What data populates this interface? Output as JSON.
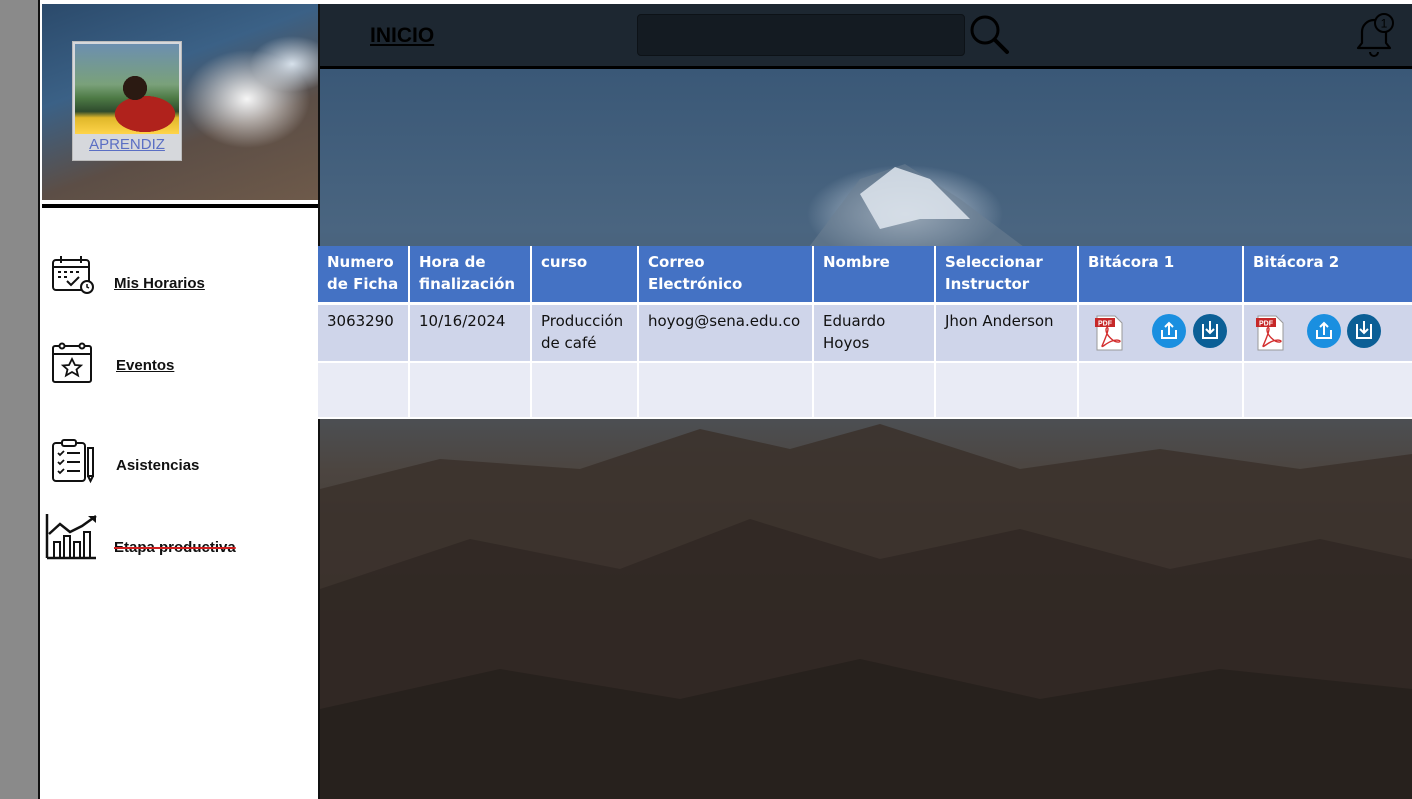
{
  "sidebar": {
    "role_label": "APRENDIZ",
    "items": [
      {
        "label": "Mis Horarios",
        "icon": "calendar-check-icon"
      },
      {
        "label": "Eventos",
        "icon": "calendar-star-icon"
      },
      {
        "label": "Asistencias",
        "icon": "clipboard-checklist-icon"
      },
      {
        "label": "Etapa productiva",
        "icon": "chart-growth-icon",
        "struck": true
      }
    ]
  },
  "topbar": {
    "title": "INICIO",
    "search_placeholder": "",
    "notification_count": "1"
  },
  "table": {
    "headers": [
      "Numero de Ficha",
      "Hora de finalización",
      "curso",
      "Correo Electrónico",
      "Nombre",
      "Seleccionar Instructor",
      "Bitácora 1",
      "Bitácora 2"
    ],
    "rows": [
      {
        "ficha": "3063290",
        "hora": "10/16/2024",
        "curso": "Producción de café",
        "correo": "hoyog@sena.edu.co",
        "nombre": "Eduardo Hoyos",
        "instructor": "Jhon Anderson"
      }
    ]
  },
  "colors": {
    "header_blue": "#4472c4",
    "row_fill": "#cfd5ea",
    "empty_row_fill": "#e9ebf5",
    "topbar": "#1d2731",
    "upload_button": "#1a8fe0",
    "download_button": "#0b5f96",
    "strike_red": "#d12020"
  }
}
